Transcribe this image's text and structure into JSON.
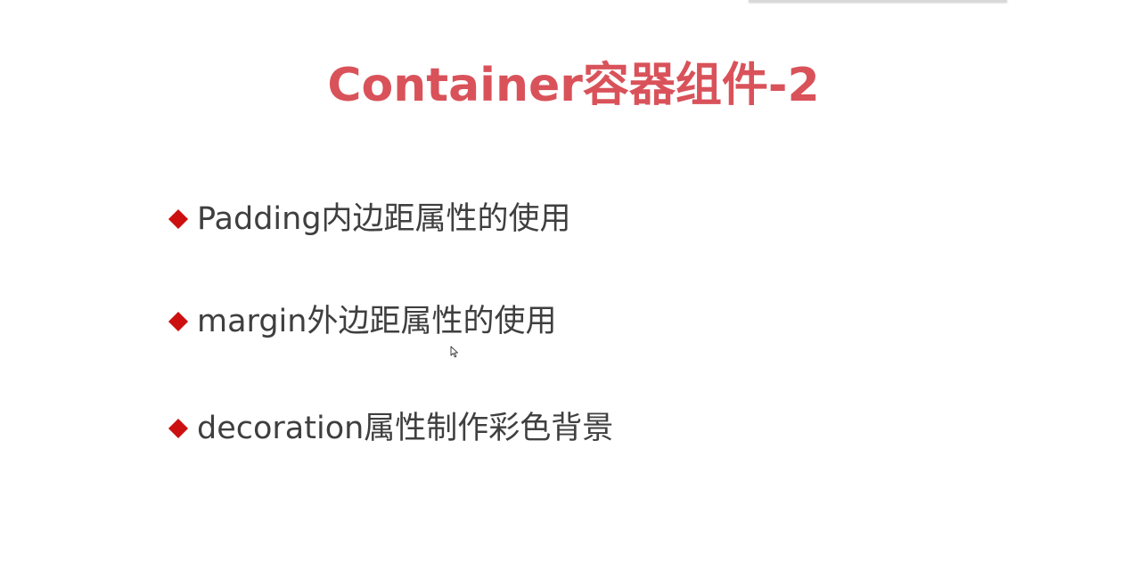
{
  "slide": {
    "title": "Container容器组件-2",
    "bullets": [
      {
        "text": "Padding内边距属性的使用"
      },
      {
        "text": "margin外边距属性的使用"
      },
      {
        "text": "decoration属性制作彩色背景"
      }
    ]
  },
  "colors": {
    "title": "#d9525a",
    "bullet_marker": "#cc1010",
    "body_text": "#3f3f3f"
  },
  "icons": {
    "bullet_marker": "diamond-icon",
    "pointer": "mouse-pointer-icon"
  }
}
